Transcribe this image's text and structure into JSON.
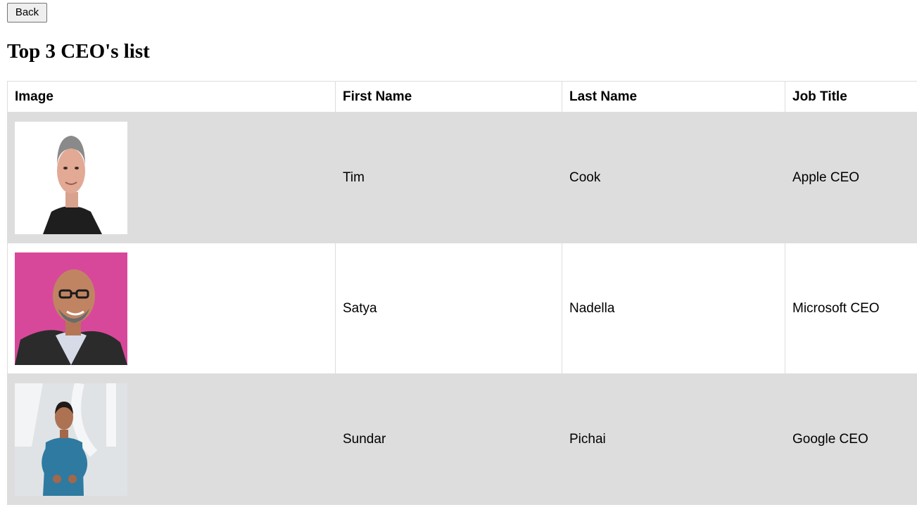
{
  "toolbar": {
    "back_label": "Back"
  },
  "page": {
    "title": "Top 3 CEO's list"
  },
  "table": {
    "headers": {
      "image": "Image",
      "first_name": "First Name",
      "last_name": "Last Name",
      "job_title": "Job Title"
    },
    "rows": [
      {
        "first_name": "Tim",
        "last_name": "Cook",
        "job_title": "Apple CEO"
      },
      {
        "first_name": "Satya",
        "last_name": "Nadella",
        "job_title": "Microsoft CEO"
      },
      {
        "first_name": "Sundar",
        "last_name": "Pichai",
        "job_title": "Google CEO"
      }
    ]
  },
  "colors": {
    "row_shade": "#dddddd",
    "border": "#dddddd",
    "photo_bg_1": "#ffffff",
    "photo_bg_2": "#d8489a",
    "photo_bg_3": "#dfe3e6"
  }
}
